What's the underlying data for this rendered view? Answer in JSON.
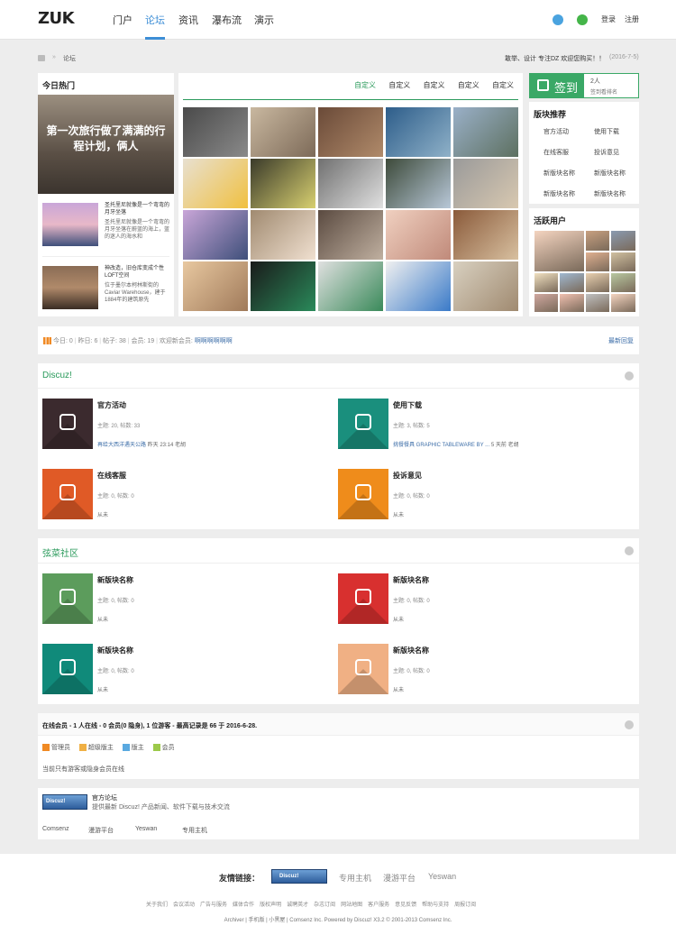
{
  "header": {
    "logo": "ZUK",
    "nav": [
      "门户",
      "论坛",
      "资讯",
      "瀑布流",
      "演示"
    ],
    "login": "登录",
    "register": "注册"
  },
  "crumb": {
    "current": "论坛",
    "notice": "敢举、设计 专注DZ 欢迎您购买！！",
    "date": "(2016-7-5)"
  },
  "hot": {
    "title": "今日热门",
    "banner_text": "第一次旅行做了满满的行程计划，俩人",
    "items": [
      {
        "title": "圣托里尼就像是一个弯弯的月牙坐落",
        "desc": "圣托里尼就像是一个弯弯的月牙坐落在蔚蓝的海上，蓝的迷人的海水和"
      },
      {
        "title": "神改造，旧仓库变成个性LOFT空间",
        "desc": "位于墨尔本柯林斯街的Caviar Warehouse，建于1884年的建筑原先"
      }
    ]
  },
  "gallery": {
    "tabs": [
      "自定义",
      "自定义",
      "自定义",
      "自定义",
      "自定义"
    ]
  },
  "checkin": {
    "label": "签到",
    "count": "2人",
    "link": "签到看排名"
  },
  "recommend": {
    "title": "版块推荐",
    "items": [
      "官方活动",
      "使用下载",
      "在线客服",
      "投诉意见",
      "新版块名称",
      "新版块名称",
      "新版块名称",
      "新版块名称"
    ]
  },
  "active": {
    "title": "活跃用户"
  },
  "stats": {
    "today_label": "今日:",
    "today": "0",
    "yesterday_label": "昨日:",
    "yesterday": "6",
    "posts_label": "帖子:",
    "posts": "38",
    "members_label": "会员:",
    "members": "19",
    "welcome_label": "欢迎新会员:",
    "newest": "啊啊啊啊啊啊",
    "latest_reply": "最新回复"
  },
  "categories": [
    {
      "title": "Discuz!",
      "forums": [
        {
          "name": "官方活动",
          "meta": "主题: 20, 帖数: 33",
          "last_link": "再给大西洋遇天公路",
          "last_rest": "昨天 23:14 老胡",
          "icon": "chart-icon",
          "color": "#3b2a2e"
        },
        {
          "name": "使用下载",
          "meta": "主题: 3, 帖数: 5",
          "last_link": "挑餐餐具 GRAPHIC TABLEWARE BY ...",
          "last_rest": "5 天前 老胡",
          "icon": "pie-icon",
          "color": "#1a8f7d"
        },
        {
          "name": "在线客服",
          "meta": "主题: 0, 帖数: 0",
          "last_link": "",
          "last_rest": "从未",
          "icon": "umbrella-icon",
          "color": "#e05a26"
        },
        {
          "name": "投诉意见",
          "meta": "主题: 0, 帖数: 0",
          "last_link": "",
          "last_rest": "从未",
          "icon": "paperplane-icon",
          "color": "#ef8c1b"
        }
      ]
    },
    {
      "title": "弦菜社区",
      "forums": [
        {
          "name": "新版块名称",
          "meta": "主题: 0, 帖数: 0",
          "last_link": "",
          "last_rest": "从未",
          "icon": "bulb-icon",
          "color": "#5c9c5c"
        },
        {
          "name": "新版块名称",
          "meta": "主题: 0, 帖数: 0",
          "last_link": "",
          "last_rest": "从未",
          "icon": "clock-icon",
          "color": "#d8302f"
        },
        {
          "name": "新版块名称",
          "meta": "主题: 0, 帖数: 0",
          "last_link": "",
          "last_rest": "从未",
          "icon": "pin-icon",
          "color": "#108a7a"
        },
        {
          "name": "新版块名称",
          "meta": "主题: 0, 帖数: 0",
          "last_link": "",
          "last_rest": "从未",
          "icon": "job-icon",
          "color": "#f0b084"
        }
      ]
    }
  ],
  "online": {
    "summary": "在线会员 - 1 人在线 - 0 会员(0 隐身), 1 位游客 - 最高记录是 66 于 2016-6-28.",
    "legend": [
      "管理员",
      "超级版主",
      "版主",
      "会员"
    ],
    "note": "当前只有游客或隐身会员在线"
  },
  "links_box": {
    "site_title": "官方论坛",
    "site_desc": "提供最新 Discuz! 产品新闻、软件下载与技术交流",
    "links": [
      "Comsenz",
      "漫游平台",
      "Yeswan",
      "专用主机"
    ]
  },
  "footer": {
    "friend_label": "友情链接：",
    "friends": [
      "专用主机",
      "漫游平台",
      "Yeswan"
    ],
    "links": [
      "关于我们",
      "会议活动",
      "广告与服务",
      "媒体合作",
      "版权声明",
      "诚聘英才",
      "杂志订阅",
      "网站地图",
      "客户服务",
      "意见反馈",
      "帮助与支持",
      "周报订阅"
    ],
    "bottom": "Archiver | 手机版 | 小黑屋 | Comsenz Inc.  Powered by Discuz! X3.2 © 2001-2013 Comsenz Inc."
  },
  "colors": {
    "accent": "#2a9a5b",
    "nav_active": "#3d8ed6"
  }
}
